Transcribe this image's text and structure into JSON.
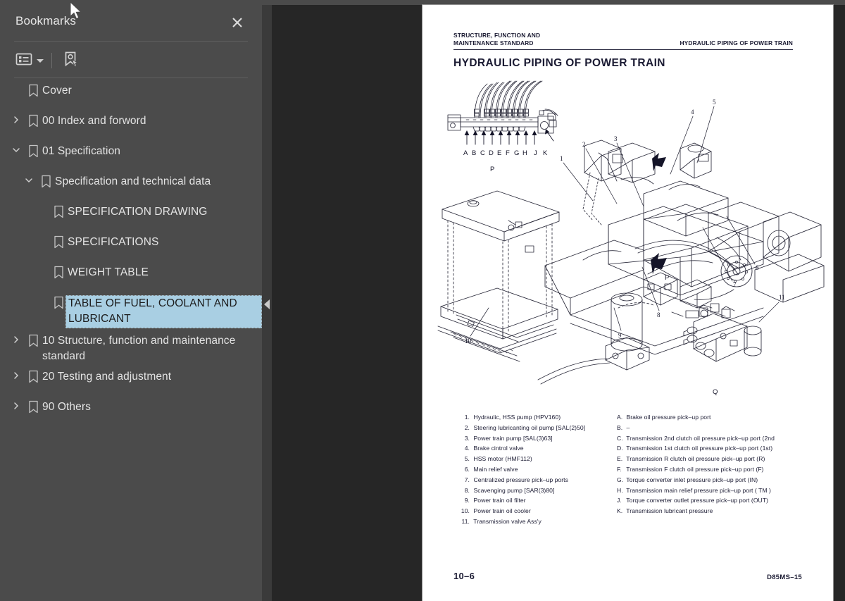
{
  "sidebar": {
    "title": "Bookmarks",
    "close_icon": "close-icon",
    "toolbar": {
      "options_icon": "list-options-icon",
      "dropdown_icon": "chevron-down-icon",
      "new_bookmark_icon": "new-bookmark-icon"
    },
    "collapse_handle_icon": "collapse-left-icon",
    "items": [
      {
        "label": "Cover",
        "level": 0,
        "twisty": "none",
        "selected": false
      },
      {
        "label": "00 Index and forword",
        "level": 0,
        "twisty": "collapsed",
        "selected": false
      },
      {
        "label": "01 Specification",
        "level": 0,
        "twisty": "expanded",
        "selected": false
      },
      {
        "label": "Specification and technical data",
        "level": 1,
        "twisty": "expanded",
        "selected": false
      },
      {
        "label": "SPECIFICATION DRAWING",
        "level": 2,
        "twisty": "none",
        "selected": false
      },
      {
        "label": "SPECIFICATIONS",
        "level": 2,
        "twisty": "none",
        "selected": false
      },
      {
        "label": "WEIGHT TABLE",
        "level": 2,
        "twisty": "none",
        "selected": false
      },
      {
        "label": "TABLE OF FUEL, COOLANT AND LUBRICANT",
        "level": 2,
        "twisty": "none",
        "selected": true
      },
      {
        "label": "10 Structure, function and maintenance standard",
        "level": 0,
        "twisty": "collapsed",
        "selected": false
      },
      {
        "label": "20 Testing and adjustment",
        "level": 0,
        "twisty": "collapsed",
        "selected": false
      },
      {
        "label": "90 Others",
        "level": 0,
        "twisty": "collapsed",
        "selected": false
      }
    ]
  },
  "document": {
    "running_header_left_line1": "STRUCTURE, FUNCTION AND",
    "running_header_left_line2": "MAINTENANCE STANDARD",
    "running_header_right": "HYDRAULIC PIPING OF POWER TRAIN",
    "page_title": "HYDRAULIC PIPING OF POWER TRAIN",
    "footer_page_number": "10–6",
    "footer_model": "D85MS–15",
    "figure": {
      "port_labels": [
        "A",
        "B",
        "C",
        "D",
        "E",
        "F",
        "G",
        "H",
        "J",
        "K"
      ],
      "callout_p_top": "P",
      "callout_p_mid": "P",
      "callout_q": "Q",
      "item_callouts": [
        "1",
        "2",
        "3",
        "4",
        "5",
        "6",
        "7",
        "8",
        "9",
        "10",
        "11"
      ]
    },
    "legend_numbered": [
      {
        "n": "1.",
        "t": "Hydraulic, HSS pump (HPV160)"
      },
      {
        "n": "2.",
        "t": "Steering lubricanting oil pump [SAL(2)50]"
      },
      {
        "n": "3.",
        "t": "Power train pump [SAL(3)63]"
      },
      {
        "n": "4.",
        "t": "Brake cintrol valve"
      },
      {
        "n": "5.",
        "t": "HSS motor (HMF112)"
      },
      {
        "n": "6.",
        "t": "Main relief valve"
      },
      {
        "n": "7.",
        "t": "Centralized pressure pick–up ports"
      },
      {
        "n": "8.",
        "t": "Scavenging pump [SAR(3)80]"
      },
      {
        "n": "9.",
        "t": "Power train oil filter"
      },
      {
        "n": "10.",
        "t": "Power train oil cooler"
      },
      {
        "n": "11.",
        "t": "Transmission valve Ass'y"
      }
    ],
    "legend_lettered": [
      {
        "n": "A.",
        "t": "Brake oil pressure pick–up port"
      },
      {
        "n": "B.",
        "t": "–"
      },
      {
        "n": "C.",
        "t": "Transmission 2nd clutch oil pressure pick–up port (2nd"
      },
      {
        "n": "D.",
        "t": "Transmission 1st clutch oil pressure pick–up port (1st)"
      },
      {
        "n": "E.",
        "t": "Transmission R clutch oil pressure pick–up port (R)"
      },
      {
        "n": "F.",
        "t": "Transmission F clutch oil pressure pick–up port (F)"
      },
      {
        "n": "G.",
        "t": "Torque converter inlet pressure pick–up port (IN)"
      },
      {
        "n": "H.",
        "t": "Transmission main relief pressure pick–up port ( TM )"
      },
      {
        "n": "J.",
        "t": "Torque converter outlet pressure pick–up port (OUT)"
      },
      {
        "n": "K.",
        "t": "Transmission lubricant pressure"
      }
    ]
  },
  "colors": {
    "sidebar_bg": "#4b4b4b",
    "viewer_bg": "#262626",
    "selection_bg": "#a9cfe3",
    "page_bg": "#ffffff",
    "text_light": "#e4e4e4",
    "doc_ink": "#1b1b33"
  }
}
